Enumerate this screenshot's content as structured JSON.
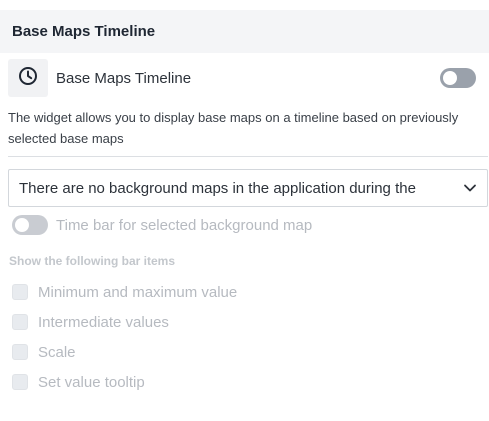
{
  "header": {
    "title": "Base Maps Timeline"
  },
  "widget": {
    "icon": "clock-icon",
    "label": "Base Maps Timeline",
    "enabled": false
  },
  "description": "The widget allows you to display base maps on a timeline based on previously selected base maps",
  "select": {
    "value": "There are no background maps in the application during the",
    "icon": "chevron-down-icon"
  },
  "time_bar": {
    "label": "Time bar for selected background map",
    "enabled": false,
    "disabled": true
  },
  "bar_items": {
    "heading": "Show the following bar items",
    "items": [
      {
        "label": "Minimum and maximum value",
        "checked": false
      },
      {
        "label": "Intermediate values",
        "checked": false
      },
      {
        "label": "Scale",
        "checked": false
      },
      {
        "label": "Set value tooltip",
        "checked": false
      }
    ]
  },
  "colors": {
    "header_bg": "#f4f5f7",
    "toggle_off": "#9aa1ab",
    "disabled_text": "#b6bac0"
  }
}
